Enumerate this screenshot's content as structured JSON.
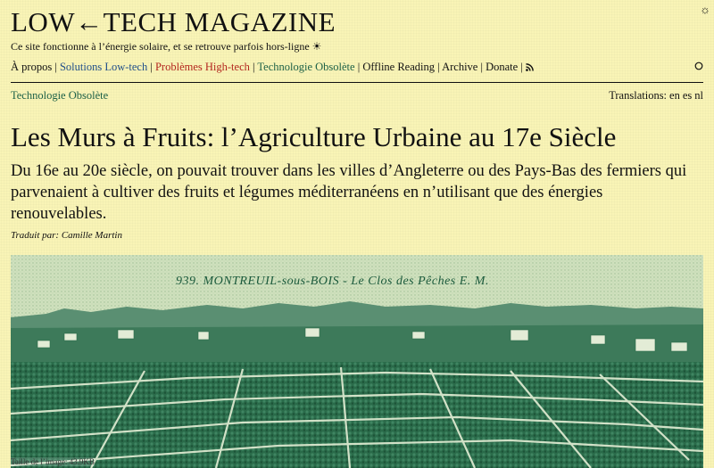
{
  "header": {
    "site_title": "LOW←TECH MAGAZINE",
    "tagline": "Ce site fonctionne à l’énergie solaire, et se retrouve parfois hors-ligne ☀",
    "battery_icon": "sun-battery-icon"
  },
  "nav": {
    "items": [
      {
        "label": "À propos",
        "color": "#111111"
      },
      {
        "label": "Solutions Low-tech",
        "color": "#1f4e8a"
      },
      {
        "label": "Problèmes High-tech",
        "color": "#b3261e"
      },
      {
        "label": "Technologie Obsolète",
        "color": "#1d6147"
      },
      {
        "label": "Offline Reading",
        "color": "#111111"
      },
      {
        "label": "Archive",
        "color": "#111111"
      },
      {
        "label": "Donate",
        "color": "#111111"
      }
    ],
    "rss_icon": "rss-icon",
    "search_icon": "search-icon"
  },
  "category": {
    "label": "Technologie Obsolète",
    "translations_label": "Translations:",
    "languages": [
      "en",
      "es",
      "nl"
    ]
  },
  "article": {
    "title": "Les Murs à Fruits: l’Agriculture Urbaine au 17e Siècle",
    "lede": "Du 16e au 20e siècle, on pouvait trouver dans les villes d’Angleterre ou des Pays-Bas des fermiers qui parvenaient à cultiver des fruits et légumes méditerranéens en n’utilisant que des énergies renouvelables.",
    "byline": "Traduit par: Camille Martin",
    "image": {
      "plate_text": "939. MONTREUIL-sous-BOIS - Le Clos des Pêches E. M.",
      "caption": "Taille de l’image: 43.9KB",
      "tint": "#1b5a3c"
    }
  }
}
